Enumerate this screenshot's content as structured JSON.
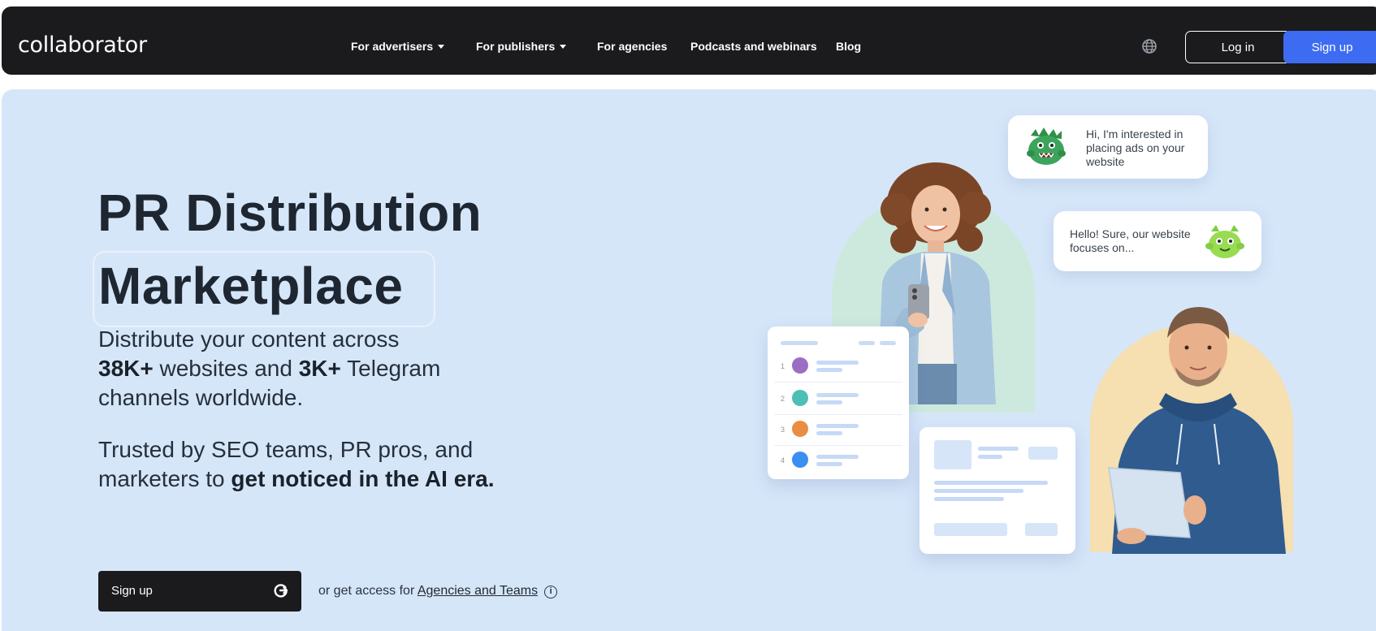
{
  "nav": {
    "logo": "collaborator",
    "items": [
      {
        "label": "For advertisers",
        "dropdown": true
      },
      {
        "label": "For publishers",
        "dropdown": true
      },
      {
        "label": "For agencies",
        "dropdown": false
      },
      {
        "label": "Podcasts and webinars",
        "dropdown": false
      },
      {
        "label": "Blog",
        "dropdown": false
      }
    ],
    "login_label": "Log in",
    "signup_label": "Sign up",
    "language_icon": "globe-icon"
  },
  "hero": {
    "title_line1": "PR Distribution",
    "title_line2": "Marketplace",
    "desc_part1": "Distribute your content across",
    "desc_stat1": "38K+",
    "desc_part2": " websites and ",
    "desc_stat2": "3K+",
    "desc_part3": " Telegram",
    "desc_part4": "channels worldwide.",
    "trust_line1": "Trusted by SEO teams, PR pros, and",
    "trust_part2": "marketers to ",
    "trust_bold": "get noticed in the AI era.",
    "signup_label": "Sign up",
    "access_text": "or get access for ",
    "access_link": "Agencies and Teams",
    "info_glyph": "i"
  },
  "illustration": {
    "bubble1": "Hi, I'm interested in placing ads on your website",
    "bubble2": "Hello! Sure, our website focuses on...",
    "list_numbers": [
      "1",
      "2",
      "3",
      "4"
    ],
    "dot_colors": [
      "#9b6ec3",
      "#4dbfb7",
      "#ea8d43",
      "#3b8ff0"
    ]
  },
  "colors": {
    "nav_bg": "#1b1b1d",
    "hero_bg": "#d6e6f9",
    "accent": "#3d6cf3"
  }
}
